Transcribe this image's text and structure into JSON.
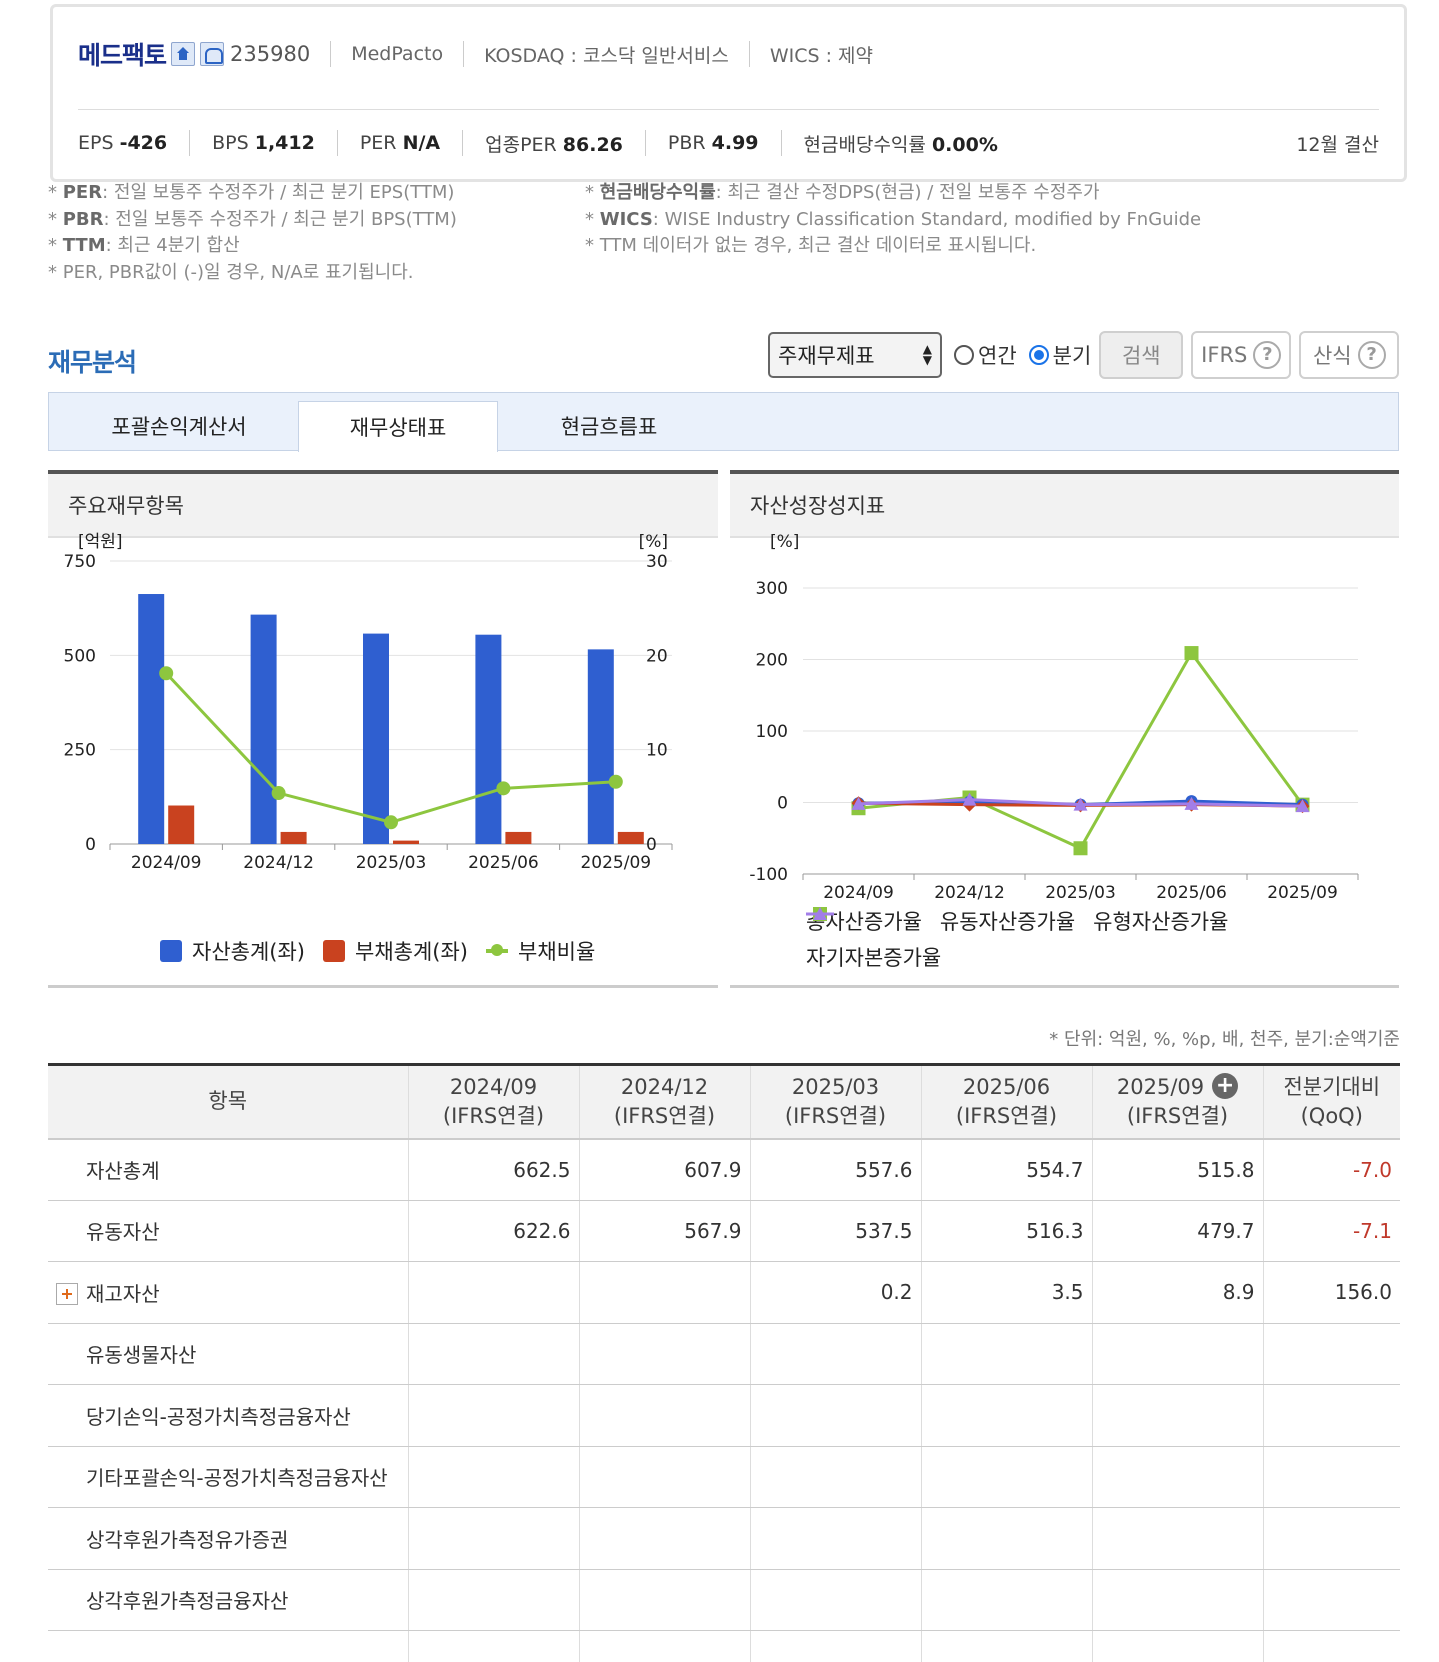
{
  "company": {
    "name": "메드팩토",
    "code": "235980",
    "english_name": "MedPacto",
    "market": "KOSDAQ : 코스닥 일반서비스",
    "wics": "WICS : 제약",
    "settlement": "12월 결산",
    "ratios": [
      {
        "label": "EPS",
        "value": "-426"
      },
      {
        "label": "BPS",
        "value": "1,412"
      },
      {
        "label": "PER",
        "value": "N/A"
      },
      {
        "label": "업종PER",
        "value": "86.26"
      },
      {
        "label": "PBR",
        "value": "4.99"
      },
      {
        "label": "현금배당수익률",
        "value": "0.00%"
      }
    ]
  },
  "notes_left": [
    {
      "key": "PER",
      "text": ": 전일 보통주 수정주가 / 최근 분기 EPS(TTM)"
    },
    {
      "key": "PBR",
      "text": ": 전일 보통주 수정주가 / 최근 분기 BPS(TTM)"
    },
    {
      "key": "TTM",
      "text": ": 최근 4분기 합산"
    },
    {
      "key": "",
      "text": "PER, PBR값이 (-)일 경우, N/A로 표기됩니다."
    }
  ],
  "notes_right": [
    {
      "key": "현금배당수익률",
      "text": ": 최근 결산 수정DPS(현금) / 전일 보통주 수정주가"
    },
    {
      "key": "WICS",
      "text": ": WISE Industry Classification Standard, modified by FnGuide"
    },
    {
      "key": "",
      "text": "TTM 데이터가 없는 경우, 최근 결산 데이터로 표시됩니다."
    }
  ],
  "section": {
    "title": "재무분석",
    "select_value": "주재무제표",
    "radio_annual": "연간",
    "radio_quarter": "분기",
    "search_button": "검색",
    "ifrs_button": "IFRS",
    "formula_button": "산식"
  },
  "tabs": [
    "포괄손익계산서",
    "재무상태표",
    "현금흐름표"
  ],
  "chart1_title": "주요재무항목",
  "chart2_title": "자산성장성지표",
  "chart_data": [
    {
      "type": "bar",
      "categories": [
        "2024/09",
        "2024/12",
        "2025/03",
        "2025/06",
        "2025/09"
      ],
      "series": [
        {
          "name": "자산총계(좌)",
          "kind": "bar",
          "axis": "left",
          "color": "#2f5fd0",
          "values": [
            662.5,
            607.9,
            557.6,
            554.7,
            515.8
          ]
        },
        {
          "name": "부채총계(좌)",
          "kind": "bar",
          "axis": "left",
          "color": "#c9421f",
          "values": [
            102,
            32,
            9,
            32,
            32
          ]
        },
        {
          "name": "부채비율",
          "kind": "line",
          "axis": "right",
          "color": "#8dc63f",
          "values": [
            18.1,
            5.4,
            2.3,
            5.9,
            6.6
          ]
        }
      ],
      "ylabel_left": "[억원]",
      "ylabel_right": "[%]",
      "ylim_left": [
        0,
        750
      ],
      "ylim_right": [
        0,
        30
      ],
      "yticks_left": [
        "750",
        "500",
        "250",
        "0"
      ],
      "yticks_right": [
        "30",
        "20",
        "10",
        "0"
      ],
      "legend": "bottom",
      "grid": true
    },
    {
      "type": "line",
      "categories": [
        "2024/09",
        "2024/12",
        "2025/03",
        "2025/06",
        "2025/09"
      ],
      "series": [
        {
          "name": "총자산증가율",
          "color": "#2f5fd0",
          "marker": "circle",
          "values": [
            -1,
            1,
            -3,
            2,
            -3
          ]
        },
        {
          "name": "유동자산증가율",
          "color": "#c9421f",
          "marker": "diamond",
          "values": [
            -1,
            -3,
            -4,
            -3,
            -5
          ]
        },
        {
          "name": "유형자산증가율",
          "color": "#8dc63f",
          "marker": "square",
          "values": [
            -8,
            7,
            -64,
            209,
            -3
          ]
        },
        {
          "name": "자기자본증가율",
          "color": "#a27ee8",
          "marker": "triangle",
          "values": [
            -2,
            4,
            -3,
            -2,
            -5
          ]
        }
      ],
      "ylabel": "[%]",
      "ylim": [
        -100,
        300
      ],
      "yticks": [
        "300",
        "200",
        "100",
        "0",
        "-100"
      ],
      "legend": "bottom",
      "grid": true
    }
  ],
  "unit_note": "* 단위: 억원, %, %p, 배, 천주, 분기:순액기준",
  "table": {
    "headers": [
      {
        "l1": "항목",
        "l2": ""
      },
      {
        "l1": "2024/09",
        "l2": "(IFRS연결)"
      },
      {
        "l1": "2024/12",
        "l2": "(IFRS연결)"
      },
      {
        "l1": "2025/03",
        "l2": "(IFRS연결)"
      },
      {
        "l1": "2025/06",
        "l2": "(IFRS연결)"
      },
      {
        "l1": "2025/09",
        "l2": "(IFRS연결)"
      },
      {
        "l1": "전분기대비",
        "l2": "(QoQ)"
      }
    ],
    "rows": [
      {
        "label": "자산총계",
        "values": [
          "662.5",
          "607.9",
          "557.6",
          "554.7",
          "515.8",
          "-7.0"
        ]
      },
      {
        "label": "유동자산",
        "values": [
          "622.6",
          "567.9",
          "537.5",
          "516.3",
          "479.7",
          "-7.1"
        ]
      },
      {
        "label": "재고자산",
        "values": [
          "",
          "",
          "0.2",
          "3.5",
          "8.9",
          "156.0"
        ],
        "expandable": true
      },
      {
        "label": "유동생물자산",
        "values": [
          "",
          "",
          "",
          "",
          "",
          ""
        ]
      },
      {
        "label": "당기손익-공정가치측정금융자산",
        "values": [
          "",
          "",
          "",
          "",
          "",
          ""
        ]
      },
      {
        "label": "기타포괄손익-공정가치측정금융자산",
        "values": [
          "",
          "",
          "",
          "",
          "",
          ""
        ]
      },
      {
        "label": "상각후원가측정유가증권",
        "values": [
          "",
          "",
          "",
          "",
          "",
          ""
        ]
      },
      {
        "label": "상각후원가측정금융자산",
        "values": [
          "",
          "",
          "",
          "",
          "",
          ""
        ]
      },
      {
        "label": "",
        "values": [
          "",
          "",
          "",
          "",
          "",
          ""
        ]
      }
    ]
  }
}
